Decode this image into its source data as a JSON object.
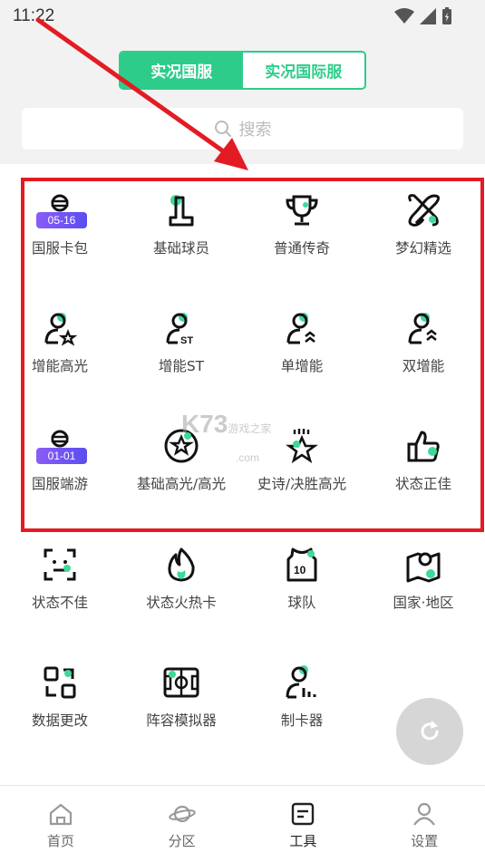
{
  "status_bar": {
    "time": "11:22"
  },
  "segments": {
    "domestic": "实况国服",
    "international": "实况国际服"
  },
  "search": {
    "placeholder": "搜索"
  },
  "tools": [
    {
      "label": "国服卡包",
      "icon": "card-pack-icon",
      "badge": "05-16"
    },
    {
      "label": "基础球员",
      "icon": "base-player-icon"
    },
    {
      "label": "普通传奇",
      "icon": "trophy-icon"
    },
    {
      "label": "梦幻精选",
      "icon": "dream-select-icon"
    },
    {
      "label": "增能高光",
      "icon": "player-star-icon"
    },
    {
      "label": "增能ST",
      "icon": "player-st-icon"
    },
    {
      "label": "单增能",
      "icon": "player-single-boost-icon"
    },
    {
      "label": "双增能",
      "icon": "player-double-boost-icon"
    },
    {
      "label": "国服端游",
      "icon": "card-pack-icon",
      "badge": "01-01"
    },
    {
      "label": "基础高光/高光",
      "icon": "star-circle-icon"
    },
    {
      "label": "史诗/决胜高光",
      "icon": "star-burst-icon"
    },
    {
      "label": "状态正佳",
      "icon": "thumbs-up-icon"
    },
    {
      "label": "状态不佳",
      "icon": "scan-face-icon"
    },
    {
      "label": "状态火热卡",
      "icon": "flame-icon"
    },
    {
      "label": "球队",
      "icon": "jersey-icon"
    },
    {
      "label": "国家·地区",
      "icon": "map-pin-icon"
    },
    {
      "label": "数据更改",
      "icon": "data-swap-icon"
    },
    {
      "label": "阵容模拟器",
      "icon": "pitch-icon"
    },
    {
      "label": "制卡器",
      "icon": "card-maker-icon"
    }
  ],
  "watermark": {
    "brand": "K73",
    "sub": "游戏之家",
    "domain": ".com"
  },
  "tabbar": [
    {
      "label": "首页",
      "icon": "home-icon"
    },
    {
      "label": "分区",
      "icon": "planet-icon"
    },
    {
      "label": "工具",
      "icon": "tools-icon",
      "active": true
    },
    {
      "label": "设置",
      "icon": "user-icon"
    }
  ],
  "colors": {
    "accent": "#2ecc8a",
    "highlight": "#e31b23",
    "badge": "#6b52f3"
  }
}
